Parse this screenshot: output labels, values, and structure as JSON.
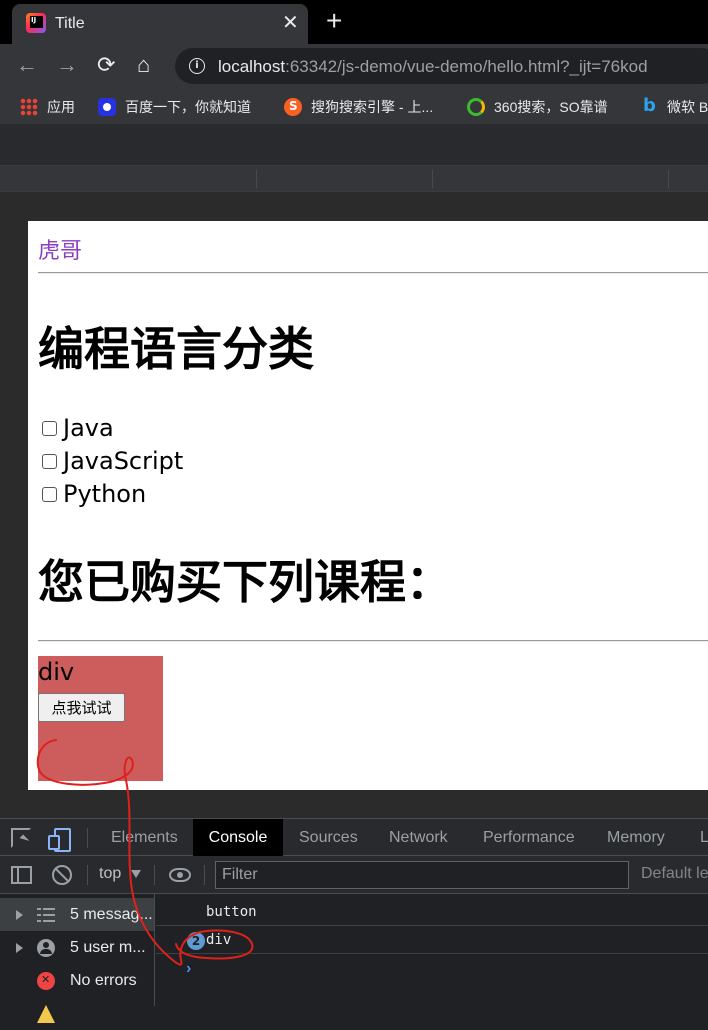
{
  "browser": {
    "tab_title": "Title",
    "close_glyph": "✕",
    "newtab_glyph": "+",
    "url_host": "localhost",
    "url_rest": ":63342/js-demo/vue-demo/hello.html?_ijt=76kod",
    "bookmarks": [
      "应用",
      "百度一下，你就知道",
      "搜狗搜索引擎 - 上...",
      "360搜索，SO靠谱",
      "微软 B"
    ]
  },
  "page": {
    "link_text": "虎哥",
    "heading_languages": "编程语言分类",
    "languages": [
      "Java",
      "JavaScript",
      "Python"
    ],
    "heading_bought": "您已购买下列课程：",
    "div_label": "div",
    "button_label": "点我试试"
  },
  "devtools": {
    "tabs": [
      "Elements",
      "Console",
      "Sources",
      "Network",
      "Performance",
      "Memory",
      "L"
    ],
    "active_tab": "Console",
    "context": "top",
    "filter_placeholder": "Filter",
    "levels_label": "Default le",
    "sidebar": [
      {
        "icon": "list-icon",
        "label": "5 messag..."
      },
      {
        "icon": "user-icon",
        "label": "5 user m..."
      },
      {
        "icon": "error-icon",
        "label": "No errors"
      }
    ],
    "logs": [
      {
        "text": "button"
      },
      {
        "count": "2",
        "text": "div"
      }
    ],
    "prompt": "›"
  },
  "colors": {
    "div_background": "#cd5c5c",
    "annotation": "#e0201c",
    "link": "#8a3fbf"
  }
}
